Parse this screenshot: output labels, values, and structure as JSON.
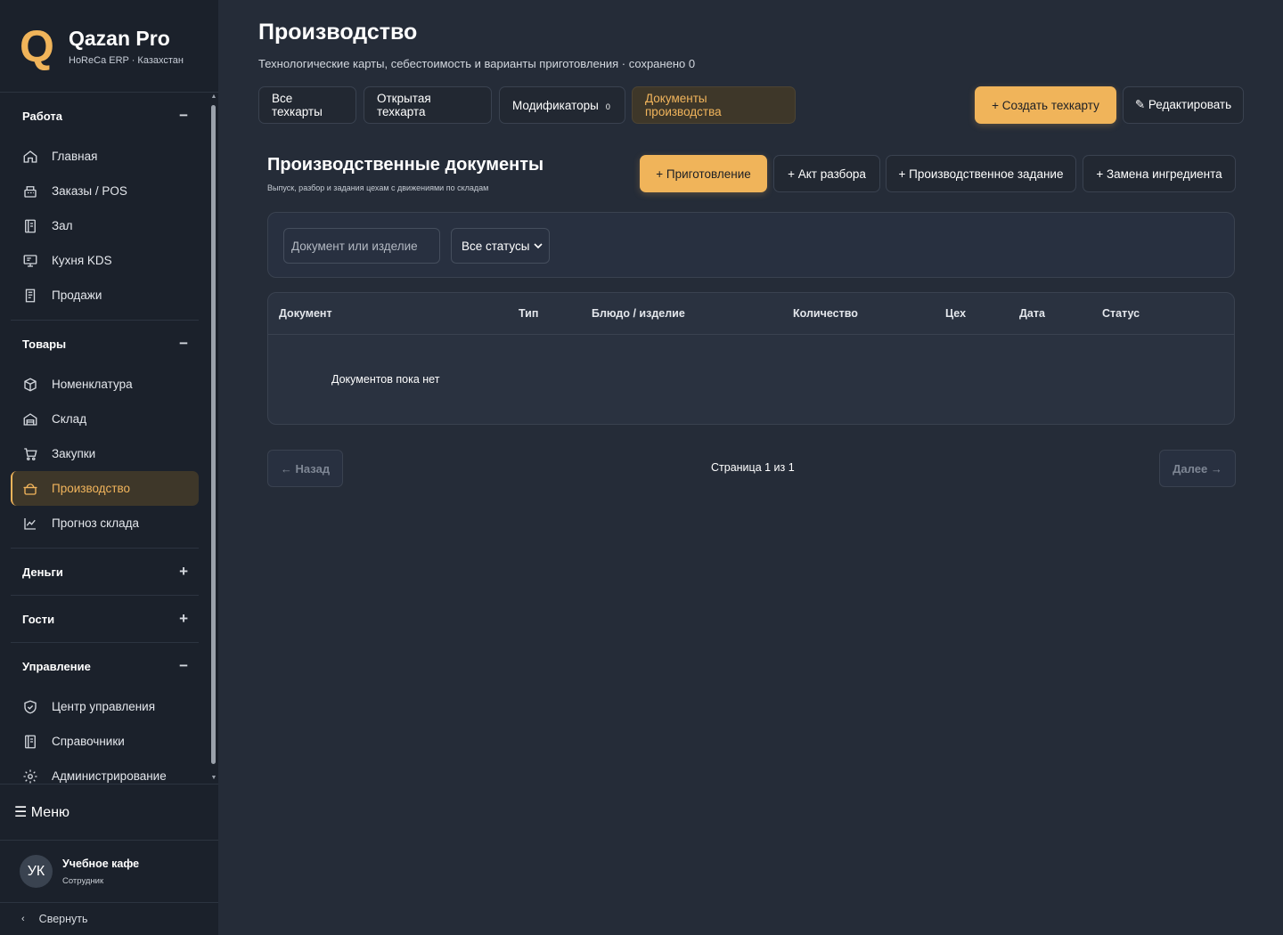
{
  "brand": {
    "logo": "Q",
    "title": "Qazan Pro",
    "subtitle": "HoReCa ERP · Казахстан"
  },
  "sidebar": {
    "groups": [
      {
        "label": "Работа",
        "toggle": "−",
        "items": [
          {
            "label": "Главная",
            "icon": "home-icon"
          },
          {
            "label": "Заказы / POS",
            "icon": "register-icon"
          },
          {
            "label": "Зал",
            "icon": "book-icon"
          },
          {
            "label": "Кухня KDS",
            "icon": "monitor-icon"
          },
          {
            "label": "Продажи",
            "icon": "receipt-icon"
          }
        ]
      },
      {
        "label": "Товары",
        "toggle": "−",
        "items": [
          {
            "label": "Номенклатура",
            "icon": "box-icon"
          },
          {
            "label": "Склад",
            "icon": "warehouse-icon"
          },
          {
            "label": "Закупки",
            "icon": "cart-icon"
          },
          {
            "label": "Производство",
            "icon": "pot-icon",
            "active": true
          },
          {
            "label": "Прогноз склада",
            "icon": "chart-icon"
          }
        ]
      },
      {
        "label": "Деньги",
        "toggle": "+"
      },
      {
        "label": "Гости",
        "toggle": "+"
      },
      {
        "label": "Управление",
        "toggle": "−",
        "items": [
          {
            "label": "Центр управления",
            "icon": "shield-icon"
          },
          {
            "label": "Справочники",
            "icon": "book-icon"
          },
          {
            "label": "Администрирование",
            "icon": "gear-icon"
          }
        ]
      }
    ],
    "menu_label": "☰ Меню",
    "user": {
      "initials": "УК",
      "name": "Учебное кафе",
      "role": "Сотрудник"
    },
    "collapse_icon": "‹",
    "collapse_label": "Свернуть"
  },
  "header": {
    "title": "Производство",
    "subtitle": "Технологические карты, себестоимость и варианты приготовления · сохранено 0"
  },
  "tabs": [
    {
      "label": "Все техкарты"
    },
    {
      "label": "Открытая техкарта"
    },
    {
      "label": "Модификаторы",
      "count": "0"
    },
    {
      "label": "Документы производства",
      "active": true
    }
  ],
  "actions": {
    "create": "+ Создать техкарту",
    "edit": "✎ Редактировать"
  },
  "section": {
    "title": "Производственные документы",
    "subtitle": "Выпуск, разбор и задания цехам с движениями по складам",
    "buttons": {
      "cook": "+ Приготовление",
      "disassembly": "+ Акт разбора",
      "task": "+ Производственное задание",
      "replace": "+ Замена ингредиента"
    }
  },
  "filters": {
    "search_placeholder": "Документ или изделие",
    "status_value": "Все статусы"
  },
  "table": {
    "columns": [
      "Документ",
      "Тип",
      "Блюдо / изделие",
      "Количество",
      "Цех",
      "Дата",
      "Статус"
    ],
    "empty_message": "Документов пока нет"
  },
  "pager": {
    "prev": "← Назад",
    "next": "Далее →",
    "text": "Страница 1 из 1"
  },
  "colors": {
    "accent": "#f0b45a",
    "sidebar_bg": "#1b212b",
    "main_bg": "#252c38",
    "active_bg": "#3e3729"
  }
}
